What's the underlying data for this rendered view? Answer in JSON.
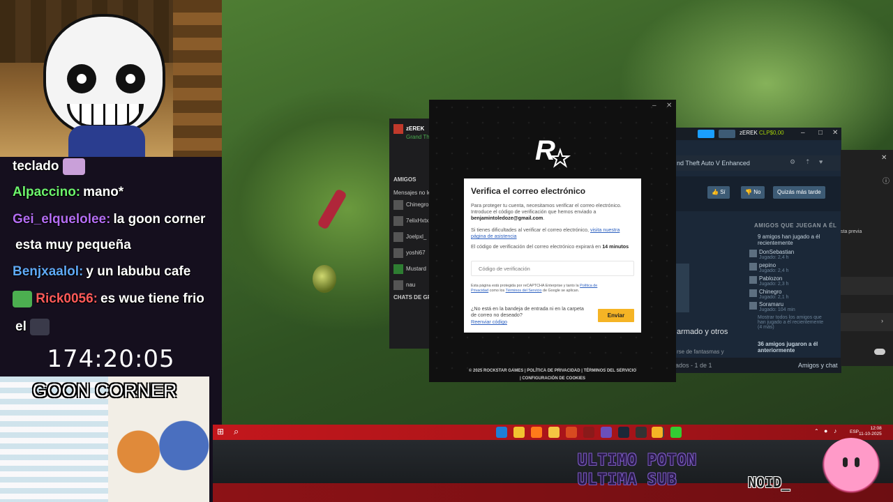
{
  "stream_overlay": {
    "chat": [
      {
        "user": "",
        "message": "teclado",
        "user_color": "#ffffff"
      },
      {
        "user": "Alpaccino:",
        "message": "mano*",
        "user_color": "#6cf26c"
      },
      {
        "user": "Gei_elquelolee:",
        "message": "la goon corner",
        "user_color": "#b36cf2"
      },
      {
        "user": "",
        "message": "esta muy pequeña",
        "user_color": "#ffffff"
      },
      {
        "user": "Benjxaalol:",
        "message": "y un labubu cafe",
        "user_color": "#5fa8f5"
      },
      {
        "user": "Rick0056:",
        "message": "es wue tiene frio",
        "user_color": "#ff5a5a"
      },
      {
        "user": "",
        "message": "el",
        "user_color": "#ffffff"
      }
    ],
    "timer": "174:20:05",
    "goon_title": "GOON CORNER",
    "ultimo_poton": "ULTIMO POTON",
    "ultima_sub": "ULTIMA SUB",
    "noid": "NOID_"
  },
  "rockstar_launcher_bg": {
    "profile_name": "zEREK",
    "profile_sub": "Grand Th",
    "friends_header": "AMIGOS",
    "messages_label": "Mensajes no le",
    "friends": [
      "Chinegro",
      "7elixHxtx",
      "Joelpxl_",
      "yoshi67",
      "Mustard",
      "nau"
    ],
    "group_chats_label": "CHATS DE GRU"
  },
  "rockstar_dialog": {
    "title": "Verifica el correo electrónico",
    "intro_text": "Para proteger tu cuenta, necesitamos verificar el correo electrónico. Introduce el código de verificación que hemos enviado a",
    "email": "benjamintoledoze@gmail.com",
    "help_prefix": "Si tienes dificultades al verificar el correo electrónico,",
    "help_link": "visita nuestra página de asistencia",
    "expiry_prefix": "El código de verificación del correo electrónico expirará en",
    "expiry_value": "14 minutos",
    "code_placeholder": "Código de verificación",
    "legal_prefix": "Esta página está protegida por reCAPTCHA Enterprise y tanto la",
    "legal_privacy_link": "Política de Privacidad",
    "legal_middle": "como los",
    "legal_terms_link": "Términos del Servicio",
    "legal_suffix": "de Google se aplican.",
    "spam_question": "¿No está en la bandeja de entrada ni en la carpeta de correo no deseado?",
    "resend_link": "Reenviar código",
    "send_button": "Enviar",
    "footer_copyright": "© 2025 ROCKSTAR GAMES",
    "footer_privacy": "POLÍTICA DE PRIVACIDAD",
    "footer_terms": "TÉRMINOS DEL SERVICIO",
    "footer_cookies": "CONFIGURACIÓN DE COOKIES",
    "minimize_glyph": "–",
    "close_glyph": "✕"
  },
  "steam_bg": {
    "username": "zEREK",
    "wallet": "CLP$0,00",
    "game_title": "nd Theft Auto V Enhanced",
    "btn_si": "Sí",
    "btn_no": "No",
    "btn_later": "Quizás más tarde",
    "friends_playing_header": "AMIGOS QUE JUEGAN A ÉL",
    "friends_recent": "9 amigos han jugado a él recientemente",
    "friends": [
      {
        "name": "DonSebastian",
        "played": "Jugado: 2,4 h"
      },
      {
        "name": "pepino",
        "played": "Jugado: 2,4 h"
      },
      {
        "name": "Pablozon",
        "played": "Jugado: 2,3 h"
      },
      {
        "name": "Chinegro",
        "played": "Jugado: 2,1 h"
      },
      {
        "name": "Soramaru",
        "played": "Jugado: 104 min"
      }
    ],
    "show_all": "Mostrar todos los amigos que han jugado a él recientemente (4 más)",
    "friends_before": "36 amigos jugaron a él anteriormente",
    "big_text": "armado y otros",
    "small_text": "rse de fantasmas y",
    "pager": "ados - 1 de 1",
    "friends_chat": "Amigos y chat",
    "preview": "sta previa"
  },
  "taskbar": {
    "lang": "ESP",
    "time": "12:08",
    "date": "11-10-2025"
  },
  "colors": {
    "taskbar_red": "#c3171c",
    "rockstar_send": "#f5b425",
    "steam_bg": "#1b2838"
  }
}
